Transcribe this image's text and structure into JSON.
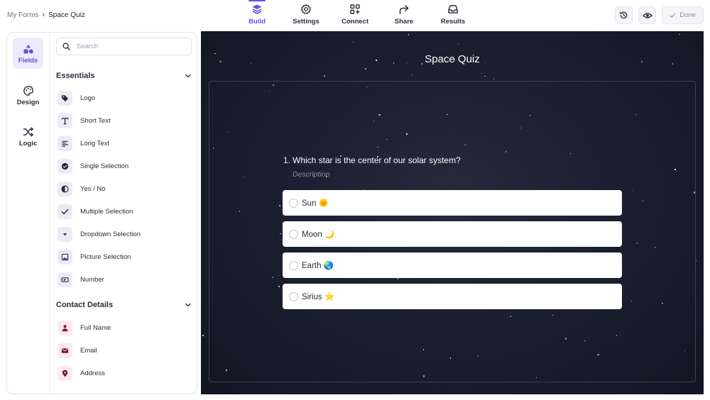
{
  "breadcrumb": {
    "parent": "My Forms",
    "separator": "›",
    "current": "Space Quiz"
  },
  "nav": {
    "tabs": [
      {
        "label": "Build",
        "icon": "layers-icon",
        "active": true
      },
      {
        "label": "Settings",
        "icon": "gear-icon",
        "active": false
      },
      {
        "label": "Connect",
        "icon": "grid-plus-icon",
        "active": false
      },
      {
        "label": "Share",
        "icon": "share-arrow-icon",
        "active": false
      },
      {
        "label": "Results",
        "icon": "inbox-icon",
        "active": false
      }
    ]
  },
  "toolbar": {
    "done_label": "Done",
    "history_icon": "history-icon",
    "preview_icon": "eye-icon",
    "done_icon": "check-icon"
  },
  "sidebar": {
    "rail": [
      {
        "label": "Fields",
        "icon": "shapes-icon",
        "active": true
      },
      {
        "label": "Design",
        "icon": "palette-icon",
        "active": false
      },
      {
        "label": "Logic",
        "icon": "shuffle-icon",
        "active": false
      }
    ],
    "search": {
      "placeholder": "Search",
      "value": ""
    },
    "sections": [
      {
        "title": "Essentials",
        "items": [
          {
            "label": "Logo",
            "icon": "tag-icon"
          },
          {
            "label": "Short Text",
            "icon": "text-t-icon"
          },
          {
            "label": "Long Text",
            "icon": "align-left-icon"
          },
          {
            "label": "Single Selection",
            "icon": "check-circle-icon"
          },
          {
            "label": "Yes / No",
            "icon": "yes-no-icon"
          },
          {
            "label": "Multiple Selection",
            "icon": "checkmark-icon"
          },
          {
            "label": "Dropdown Selection",
            "icon": "dropdown-icon"
          },
          {
            "label": "Picture Selection",
            "icon": "image-icon"
          },
          {
            "label": "Number",
            "icon": "number-icon"
          }
        ]
      },
      {
        "title": "Contact Details",
        "items": [
          {
            "label": "Full Name",
            "icon": "person-icon"
          },
          {
            "label": "Email",
            "icon": "envelope-icon"
          },
          {
            "label": "Address",
            "icon": "location-pin-icon"
          }
        ]
      }
    ]
  },
  "preview": {
    "form_title": "Space Quiz",
    "question": {
      "number": "1.",
      "text": "Which star is the center of our solar system?",
      "description": "Description",
      "options": [
        "Sun 🌞",
        "Moon 🌙",
        "Earth 🌏",
        "Sirius ⭐"
      ]
    }
  },
  "colors": {
    "accent": "#6a4fd6",
    "preview_background": "#1b2030",
    "icon_tile": "#ecebf5",
    "contact_icon": "#7a1430"
  }
}
